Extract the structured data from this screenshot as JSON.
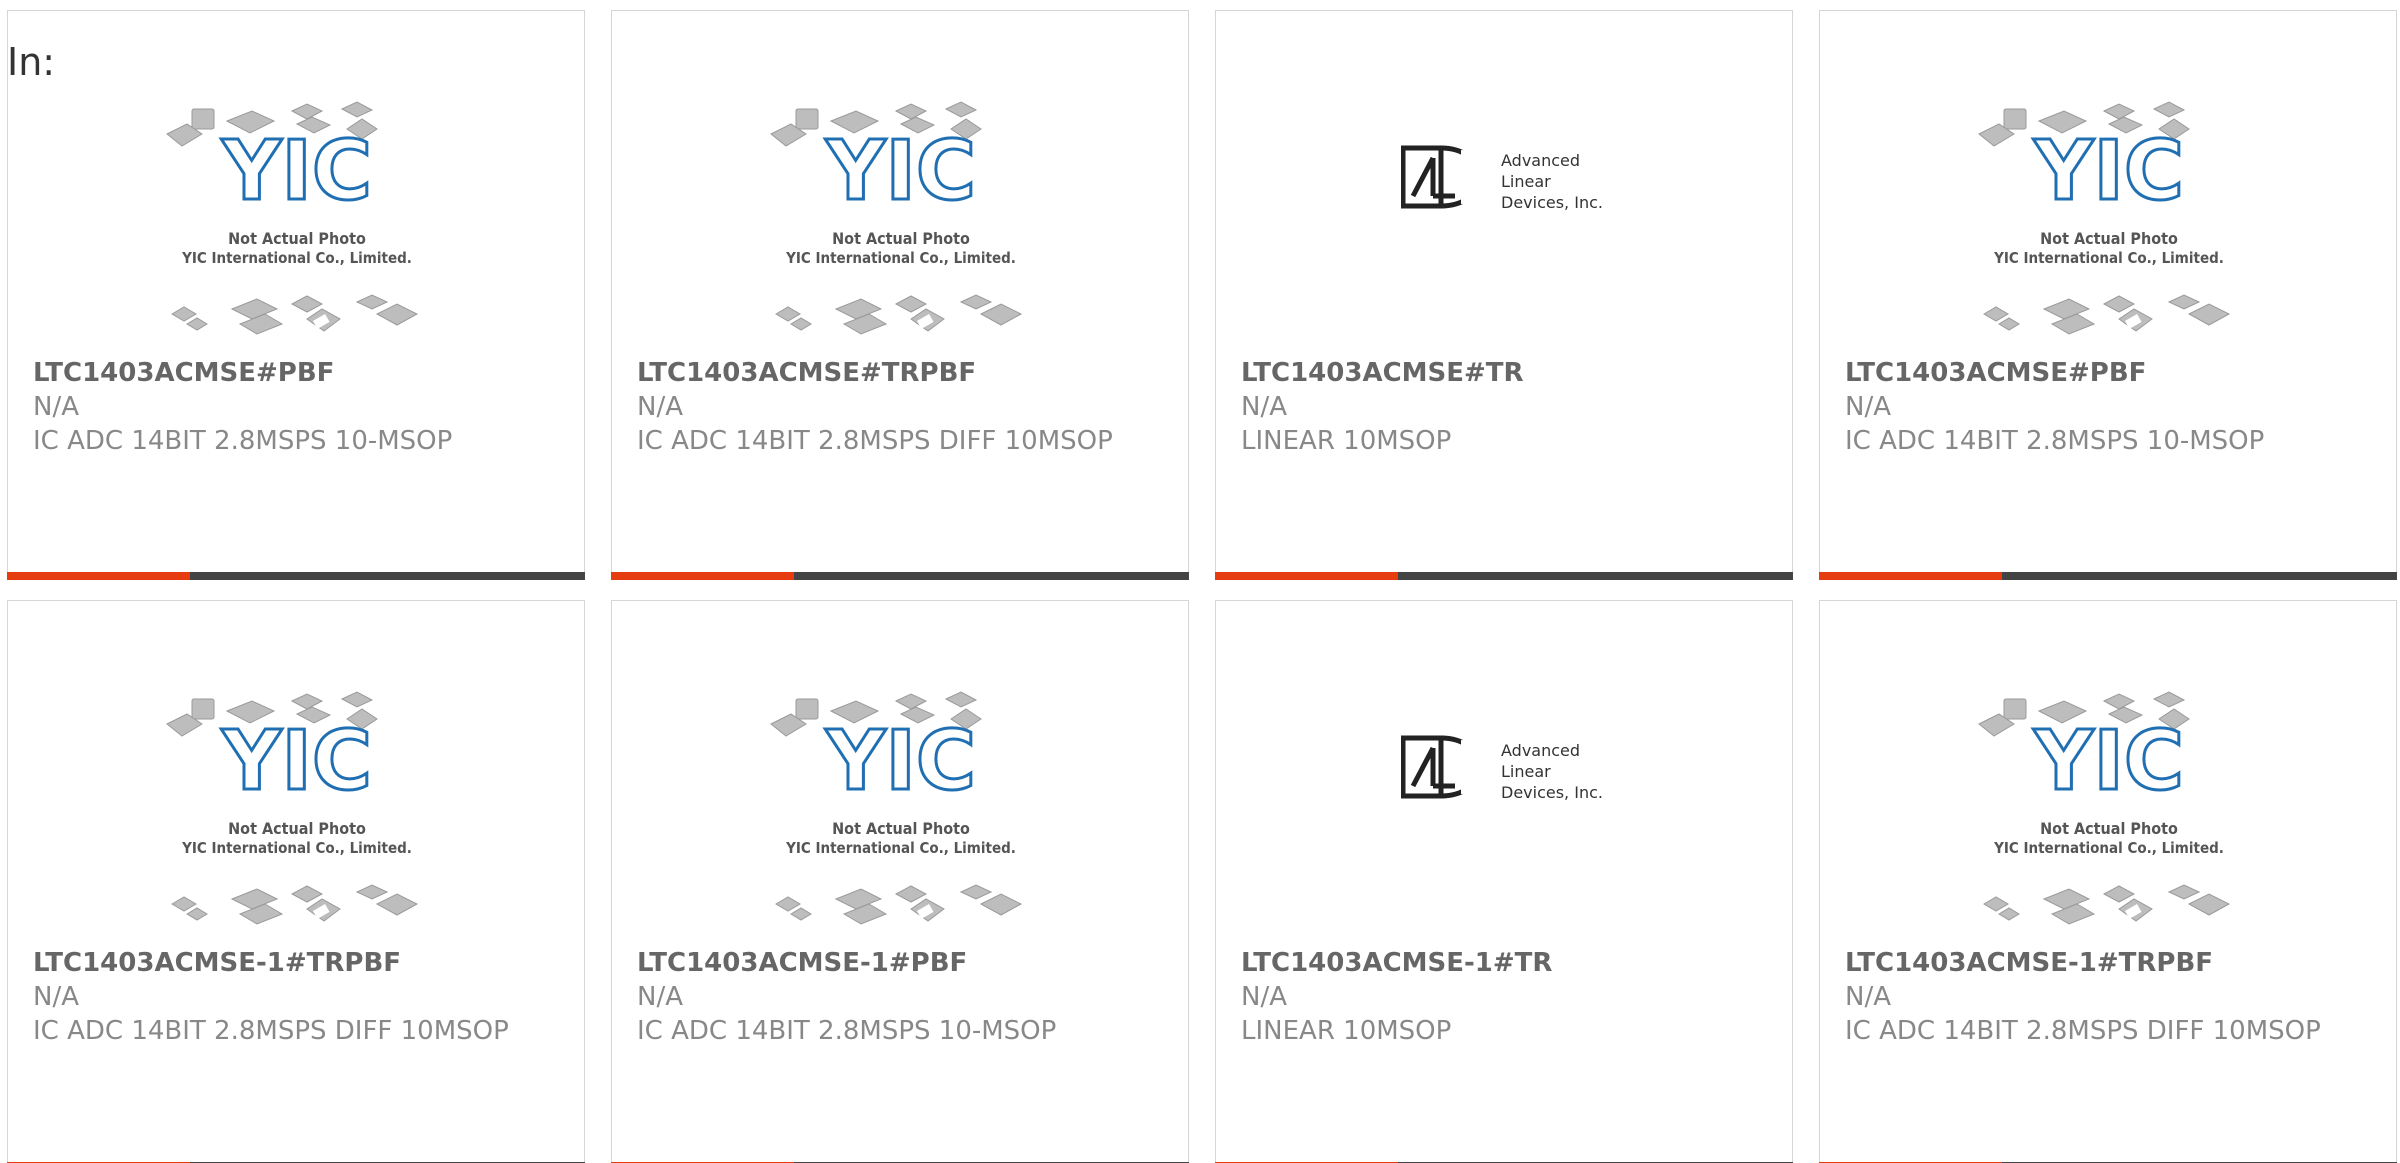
{
  "page": {
    "filter_label": "In:"
  },
  "theme": {
    "accent": "#e63c10",
    "bar": "#444444"
  },
  "cards": [
    {
      "part": "LTC1403ACMSE#PBF",
      "mfr": "N/A",
      "desc": "IC ADC 14BIT 2.8MSPS 10-MSOP",
      "image": "yic-placeholder"
    },
    {
      "part": "LTC1403ACMSE#TRPBF",
      "mfr": "N/A",
      "desc": "IC ADC 14BIT 2.8MSPS DIFF 10MSOP",
      "image": "yic-placeholder"
    },
    {
      "part": "LTC1403ACMSE#TR",
      "mfr": "N/A",
      "desc": "LINEAR 10MSOP",
      "image": "ald-logo"
    },
    {
      "part": "LTC1403ACMSE#PBF",
      "mfr": "N/A",
      "desc": "IC ADC 14BIT 2.8MSPS 10-MSOP",
      "image": "yic-placeholder"
    },
    {
      "part": "LTC1403ACMSE-1#TRPBF",
      "mfr": "N/A",
      "desc": "IC ADC 14BIT 2.8MSPS DIFF 10MSOP",
      "image": "yic-placeholder"
    },
    {
      "part": "LTC1403ACMSE-1#PBF",
      "mfr": "N/A",
      "desc": "IC ADC 14BIT 2.8MSPS 10-MSOP",
      "image": "yic-placeholder"
    },
    {
      "part": "LTC1403ACMSE-1#TR",
      "mfr": "N/A",
      "desc": "LINEAR 10MSOP",
      "image": "ald-logo"
    },
    {
      "part": "LTC1403ACMSE-1#TRPBF",
      "mfr": "N/A",
      "desc": "IC ADC 14BIT 2.8MSPS DIFF 10MSOP",
      "image": "yic-placeholder"
    }
  ],
  "yic_text": {
    "line1": "Not Actual Photo",
    "line2": "YIC International Co., Limited.",
    "logo": "YIC"
  },
  "ald_text": {
    "line1": "Advanced",
    "line2": "Linear",
    "line3": "Devices, Inc."
  }
}
